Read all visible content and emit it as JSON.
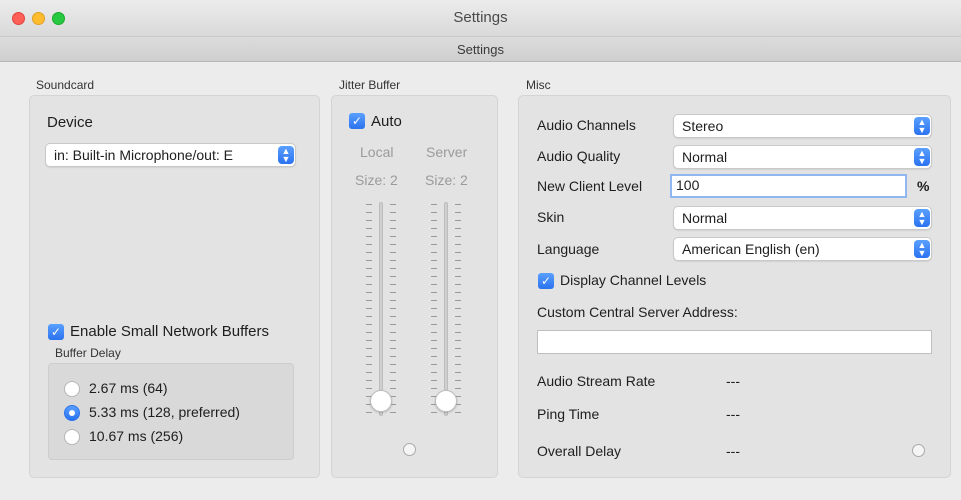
{
  "window": {
    "title": "Settings",
    "tab_title": "Settings"
  },
  "soundcard": {
    "group_title": "Soundcard",
    "device_label": "Device",
    "device_value": "in: Built-in Microphone/out: E",
    "small_buffers_label": "Enable Small Network Buffers",
    "small_buffers_checked": true,
    "buffer_delay_label": "Buffer Delay",
    "buffer_options": [
      {
        "label": "2.67 ms (64)",
        "selected": false
      },
      {
        "label": "5.33 ms (128, preferred)",
        "selected": true
      },
      {
        "label": "10.67 ms (256)",
        "selected": false
      }
    ]
  },
  "jitter": {
    "group_title": "Jitter Buffer",
    "auto_label": "Auto",
    "auto_checked": true,
    "local_label": "Local",
    "server_label": "Server",
    "local_size": "Size: 2",
    "server_size": "Size: 2"
  },
  "misc": {
    "group_title": "Misc",
    "audio_channels_label": "Audio Channels",
    "audio_channels_value": "Stereo",
    "audio_quality_label": "Audio Quality",
    "audio_quality_value": "Normal",
    "new_client_level_label": "New Client Level",
    "new_client_level_value": "100",
    "percent_unit": "%",
    "skin_label": "Skin",
    "skin_value": "Normal",
    "language_label": "Language",
    "language_value": "American English (en)",
    "display_levels_label": "Display Channel Levels",
    "display_levels_checked": true,
    "custom_server_label": "Custom Central Server Address:",
    "custom_server_value": "",
    "audio_stream_rate_label": "Audio Stream Rate",
    "audio_stream_rate_value": "---",
    "ping_time_label": "Ping Time",
    "ping_time_value": "---",
    "overall_delay_label": "Overall Delay",
    "overall_delay_value": "---"
  },
  "icons": {
    "popup_stepper": "up-down-chevron-icon",
    "checkbox": "checkmark-icon",
    "status_led": "status-led-icon"
  },
  "colors": {
    "accent": "#2a72f0",
    "panel": "#e3e3e3",
    "window": "#ececec"
  }
}
